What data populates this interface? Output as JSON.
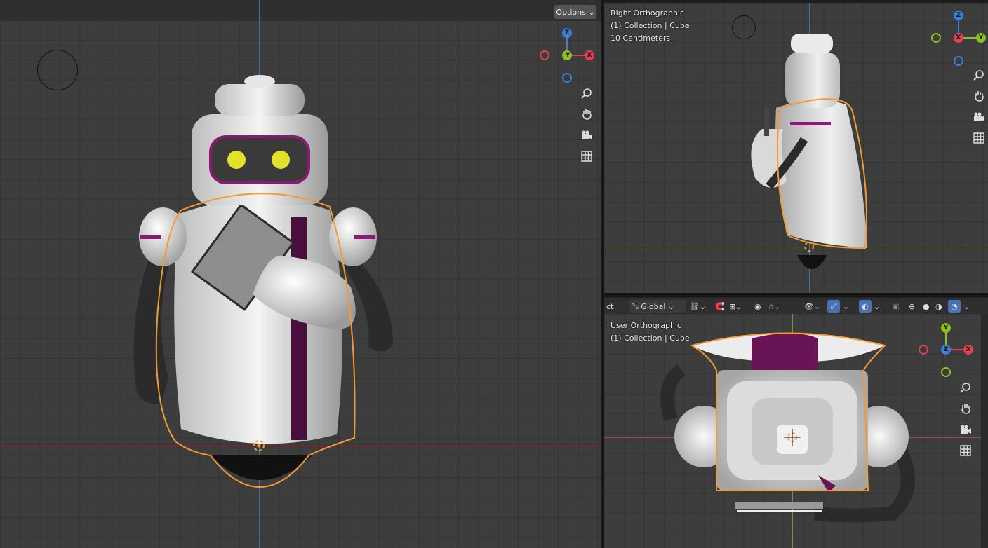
{
  "main_viewport": {
    "options_label": "Options"
  },
  "right_viewport": {
    "view_name": "Right Orthographic",
    "collection": "(1) Collection | Cube",
    "scale": "10 Centimeters"
  },
  "user_viewport": {
    "view_name": "User Orthographic",
    "collection": "(1) Collection | Cube"
  },
  "header": {
    "mode_fragment": "ct",
    "orientation": "Global"
  },
  "gizmo_front": {
    "up": "Z",
    "left": "-Y",
    "right": "X"
  },
  "gizmo_right": {
    "up": "Z",
    "left": "Y",
    "center": "X",
    "right": "Y"
  },
  "gizmo_user": {
    "up": "Y",
    "left": "X",
    "center": "Z",
    "right": "X"
  },
  "nav_icons": [
    "zoom-icon",
    "hand-pan-icon",
    "camera-icon",
    "grid-icon"
  ],
  "colors": {
    "x_axis": "#e04050",
    "y_axis": "#8bc21f",
    "z_axis": "#3a7fd8",
    "selection_outline": "#f29b33",
    "accent_purple": "#8a1a75",
    "eye_yellow": "#e3e12a"
  }
}
